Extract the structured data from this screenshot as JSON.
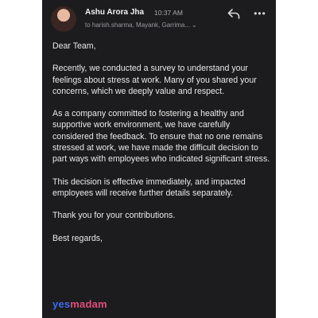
{
  "email": {
    "sender": "Ashu Arora Jha",
    "time": "10:37 AM",
    "recipients": "to harish.sharma, Mayank, Garrima...",
    "greeting": "Dear Team,",
    "paragraphs": [
      "Recently, we conducted a survey to understand your feelings about stress at work. Many of you shared your concerns, which we deeply value and respect.",
      "As a company committed to fostering a healthy and supportive work environment, we have carefully considered the feedback. To ensure that no one remains stressed at work, we have made the difficult decision to part ways with employees who indicated significant stress.",
      "This decision is effective immediately, and impacted employees will receive further details separately.",
      "Thank you for your contributions."
    ],
    "signoff": "Best regards,"
  },
  "signature": {
    "logo_part1": "yes",
    "logo_part2": "madam"
  },
  "icons": {
    "reply": "reply-icon",
    "more": "more-options-icon",
    "recipients_toggle": "chevron-down-icon",
    "avatar": "sender-avatar"
  },
  "colors": {
    "background": "#1c1c1e",
    "text": "#e9e9e9",
    "logo_blue": "#3b6cf0",
    "logo_pink": "#e24c7a"
  }
}
